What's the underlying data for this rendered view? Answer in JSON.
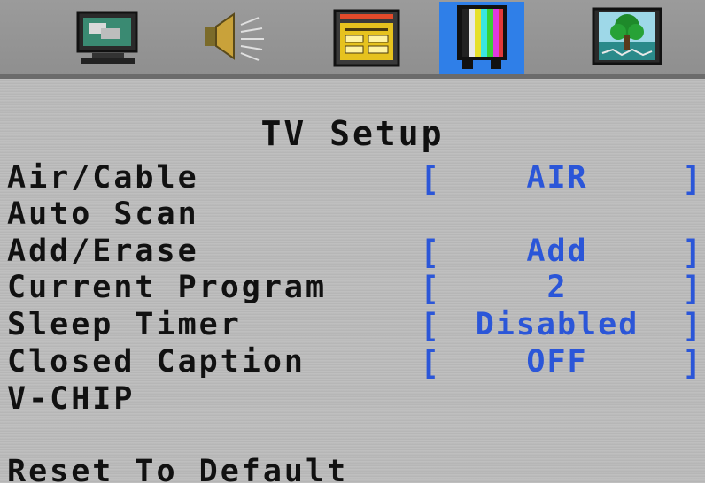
{
  "icon_tabs": [
    {
      "icon": "display-icon",
      "active": false
    },
    {
      "icon": "speaker-icon",
      "active": false
    },
    {
      "icon": "program-guide-icon",
      "active": false
    },
    {
      "icon": "tv-color-bars-icon",
      "active": true
    },
    {
      "icon": "picture-tree-icon",
      "active": false
    }
  ],
  "menu": {
    "title": "TV Setup",
    "items": [
      {
        "label": "Air/Cable",
        "value": "AIR"
      },
      {
        "label": "Auto Scan",
        "value": ""
      },
      {
        "label": "Add/Erase",
        "value": "Add"
      },
      {
        "label": "Current Program",
        "value": "2"
      },
      {
        "label": "Sleep Timer",
        "value": "Disabled"
      },
      {
        "label": "Closed Caption",
        "value": "OFF"
      },
      {
        "label": "V-CHIP",
        "value": ""
      },
      {
        "label": "Reset To Default",
        "value": ""
      }
    ]
  },
  "brackets": {
    "open": "[",
    "close": "]"
  },
  "colors": {
    "active_tab": "#2f7fe8",
    "value_text": "#2b56d8",
    "label_text": "#111111",
    "menu_background": "#bcbcbc"
  }
}
